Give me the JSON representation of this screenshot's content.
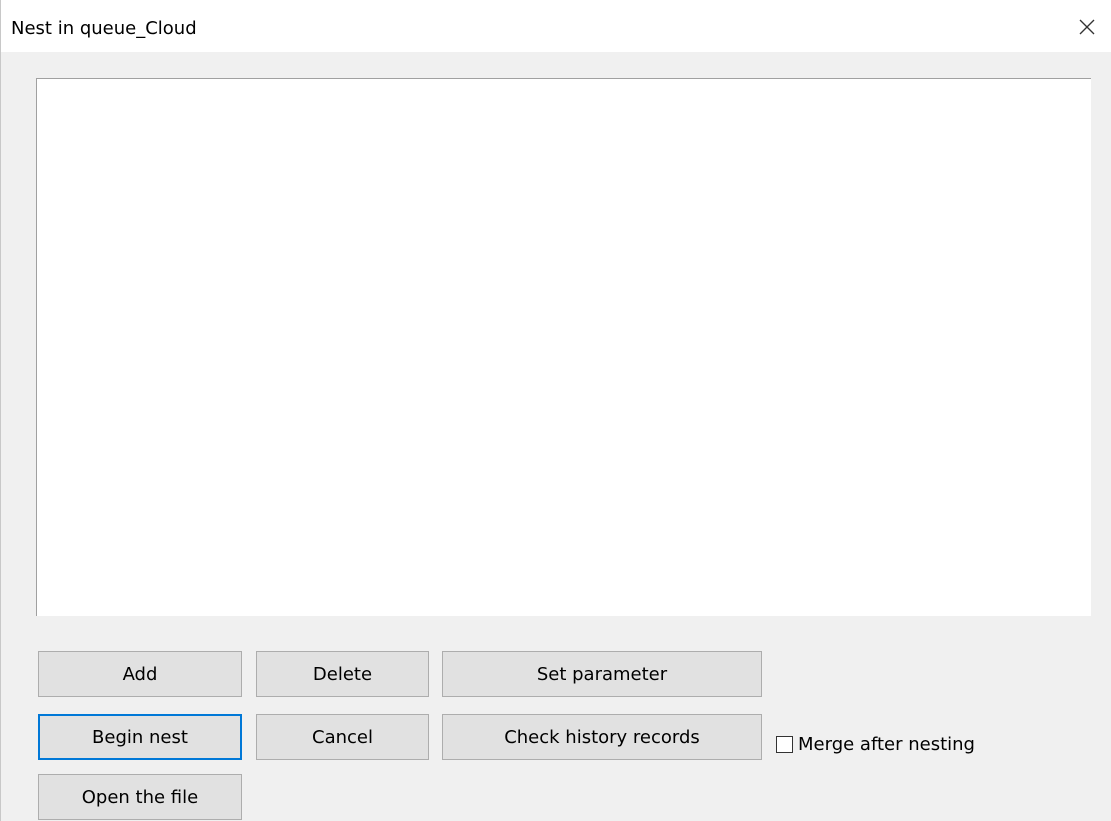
{
  "window": {
    "title": "Nest in queue_Cloud",
    "close_icon": "close-icon"
  },
  "buttons": {
    "add": "Add",
    "delete": "Delete",
    "set_parameter": "Set parameter",
    "begin_nest": "Begin nest",
    "cancel": "Cancel",
    "check_history": "Check history records",
    "open_file": "Open the file"
  },
  "options": {
    "merge_after_nesting": {
      "label": "Merge after nesting",
      "checked": false
    }
  },
  "colors": {
    "focus_border": "#0078d7",
    "button_bg": "#e1e1e1",
    "window_bg": "#f0f0f0"
  }
}
